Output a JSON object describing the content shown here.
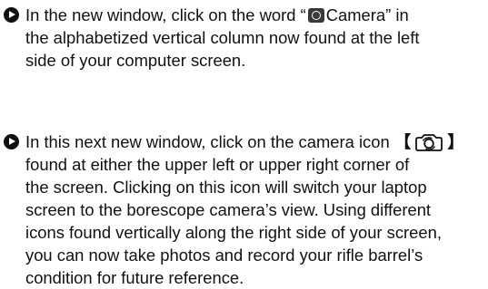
{
  "step1": {
    "line1_before_icon": "In the new window, click on the word  “",
    "line1_after_icon": "Camera”  in",
    "line2": "the alphabetized vertical column now found at the left",
    "line3": "side of your computer screen.",
    "inline_icon": "camera-app-icon"
  },
  "step2": {
    "line1_before_icon": "In this next new window, click on the camera icon",
    "bracket_open": "【",
    "bracket_close": "】",
    "line2": "found at either the upper left or upper right corner of",
    "line3": "the screen. Clicking on this icon will switch your laptop",
    "line4": "screen to the borescope camera’s view. Using different",
    "line5": "icons found vertically along the right side of your screen,",
    "line6": "you can now take photos and record your rifle barrel’s",
    "line7": "condition for future reference.",
    "inline_icon": "camera-switch-icon"
  },
  "bullet_icon": "play-circle-icon",
  "text_color": "#111111"
}
